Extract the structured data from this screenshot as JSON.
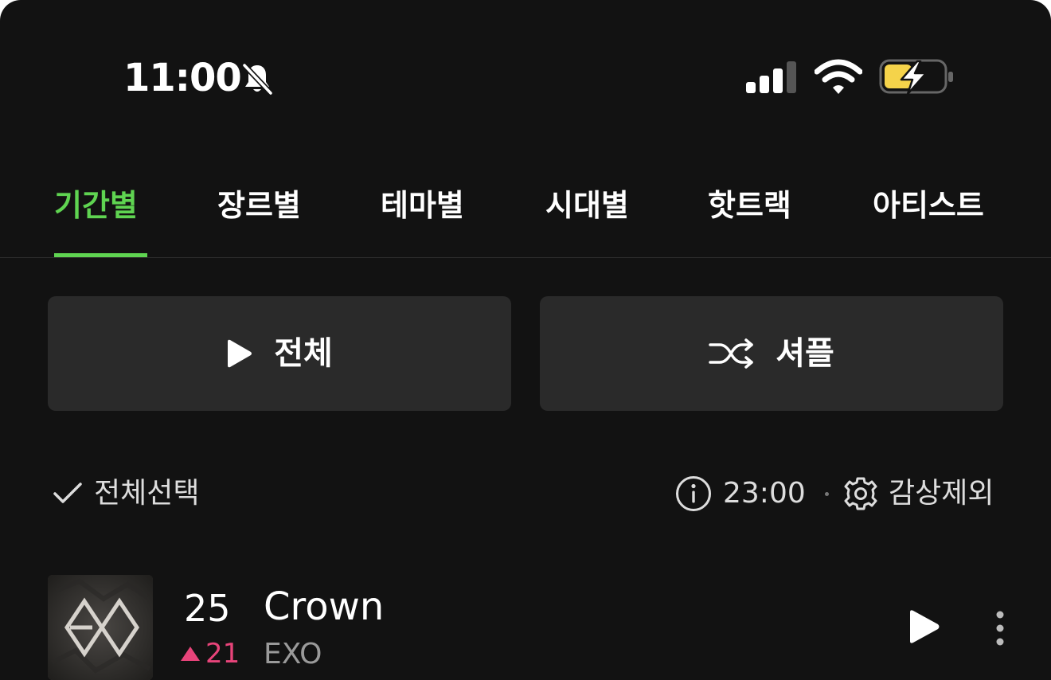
{
  "status_bar": {
    "time": "11:00"
  },
  "tabs": [
    {
      "label": "기간별",
      "active": true
    },
    {
      "label": "장르별",
      "active": false
    },
    {
      "label": "테마별",
      "active": false
    },
    {
      "label": "시대별",
      "active": false
    },
    {
      "label": "핫트랙",
      "active": false
    },
    {
      "label": "아티스트",
      "active": false
    }
  ],
  "actions": {
    "play_all_label": "전체",
    "shuffle_label": "셔플"
  },
  "options": {
    "select_all_label": "전체선택",
    "timer_label": "23:00",
    "exclude_label": "감상제외"
  },
  "songs": [
    {
      "rank": "25",
      "change": "21",
      "change_direction": "up",
      "title": "Crown",
      "artist": "EXO"
    }
  ],
  "colors": {
    "accent": "#5fd451",
    "background": "#121212",
    "button_bg": "#2a2a2a",
    "rank_up": "#e8447a",
    "battery_fill": "#f5d34a"
  },
  "icons": {
    "bell_off": "bell-slash-icon",
    "signal": "cellular-signal-icon",
    "wifi": "wifi-icon",
    "battery": "battery-charging-icon",
    "play": "play-icon",
    "shuffle": "shuffle-icon",
    "check": "check-icon",
    "info": "info-icon",
    "gear": "gear-icon",
    "more": "more-vertical-icon"
  }
}
